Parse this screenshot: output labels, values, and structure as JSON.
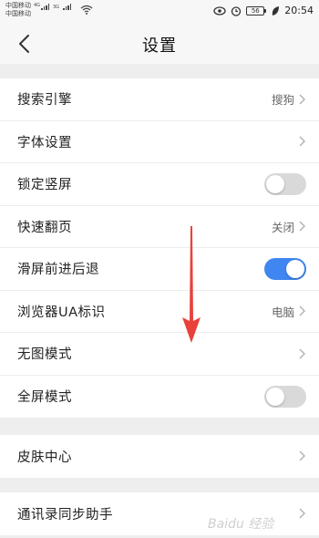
{
  "status_bar": {
    "carrier_1": "中国移动",
    "carrier_2": "中国移动",
    "signal_1_tag": "4G",
    "signal_2_tag": "3G",
    "battery": "56",
    "time": "20:54"
  },
  "header": {
    "title": "设置",
    "back_icon": "chevron-left-icon"
  },
  "sections": [
    {
      "rows": [
        {
          "label": "搜索引擎",
          "value": "搜狗",
          "control": "chevron"
        },
        {
          "label": "字体设置",
          "value": "",
          "control": "chevron"
        },
        {
          "label": "锁定竖屏",
          "control": "toggle",
          "on": false
        },
        {
          "label": "快速翻页",
          "value": "关闭",
          "control": "chevron"
        },
        {
          "label": "滑屏前进后退",
          "control": "toggle",
          "on": true
        },
        {
          "label": "浏览器UA标识",
          "value": "电脑",
          "control": "chevron"
        },
        {
          "label": "无图模式",
          "value": "",
          "control": "chevron"
        },
        {
          "label": "全屏模式",
          "control": "toggle",
          "on": false
        }
      ]
    },
    {
      "rows": [
        {
          "label": "皮肤中心",
          "value": "",
          "control": "chevron"
        }
      ]
    },
    {
      "rows": [
        {
          "label": "通讯录同步助手",
          "value": "",
          "control": "chevron"
        }
      ]
    }
  ],
  "colors": {
    "toggle_on": "#3f86f0",
    "toggle_off": "#d9d9d9",
    "annotation_arrow": "#e8413a",
    "background": "#eeeeee"
  },
  "annotation": {
    "icon": "red-down-arrow-icon"
  },
  "watermark": {
    "text": "Baidu 经验"
  }
}
